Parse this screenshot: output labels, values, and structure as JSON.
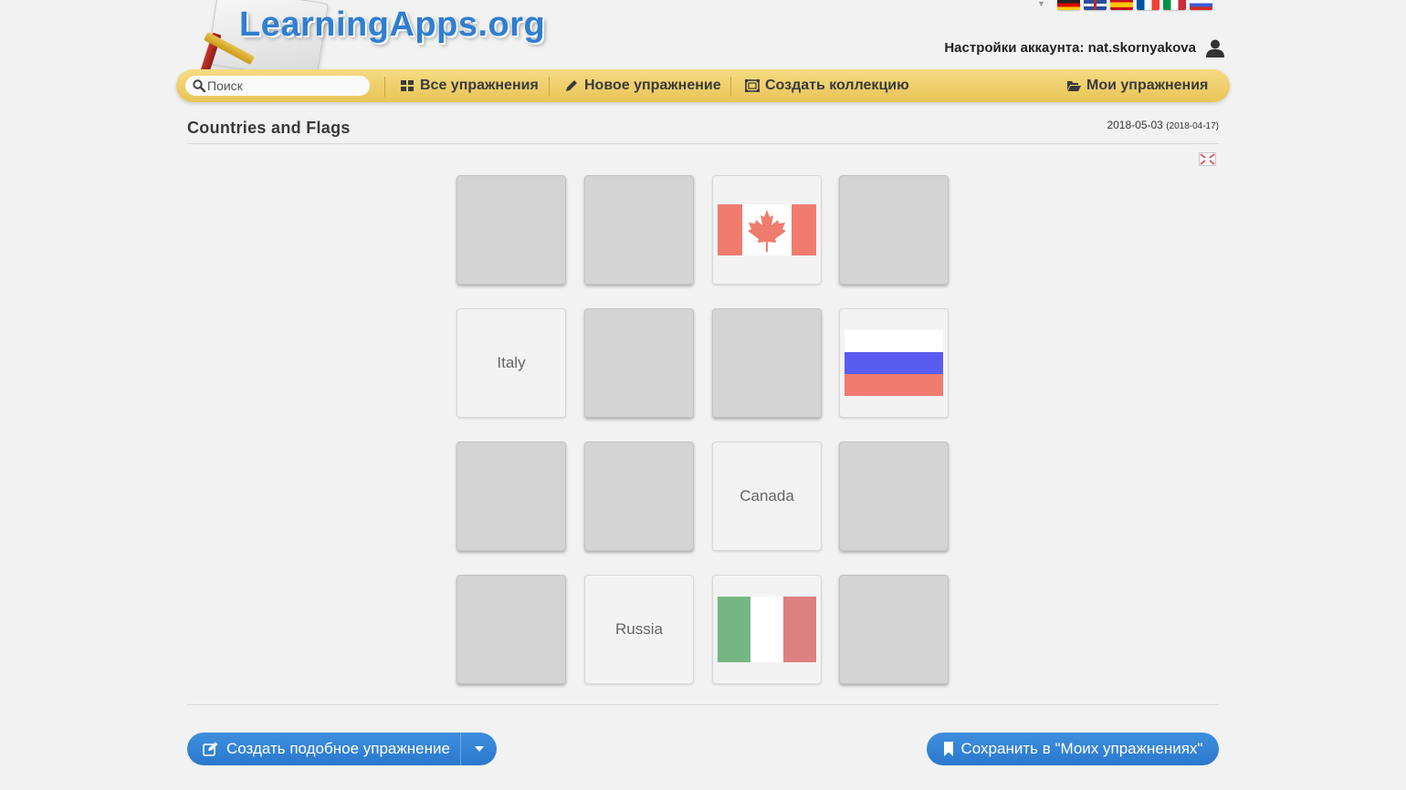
{
  "header": {
    "logo_text": "LearningApps.org",
    "account_label": "Настройки аккаунта: nat.skornyakova",
    "languages": [
      "de",
      "en",
      "es",
      "fr",
      "it",
      "ru"
    ]
  },
  "nav": {
    "search_placeholder": "Поиск",
    "all_exercises": "Все упражнения",
    "new_exercise": "Новое упражнение",
    "create_collection": "Создать коллекцию",
    "my_exercises": "Мои упражнения"
  },
  "page": {
    "title": "Countries and Flags",
    "date": "2018-05-03",
    "date_created": "(2018-04-17)"
  },
  "cards": [
    {
      "state": "hidden"
    },
    {
      "state": "hidden"
    },
    {
      "state": "open",
      "flag": "canada"
    },
    {
      "state": "hidden"
    },
    {
      "state": "open",
      "text": "Italy"
    },
    {
      "state": "hidden"
    },
    {
      "state": "hidden"
    },
    {
      "state": "open",
      "flag": "russia"
    },
    {
      "state": "hidden"
    },
    {
      "state": "hidden"
    },
    {
      "state": "open",
      "text": "Canada"
    },
    {
      "state": "hidden"
    },
    {
      "state": "hidden"
    },
    {
      "state": "open",
      "text": "Russia"
    },
    {
      "state": "open",
      "flag": "italy"
    },
    {
      "state": "hidden"
    }
  ],
  "colors": {
    "canada_red": "#f07b6f",
    "russia_blue": "#5a5cf0",
    "russia_red": "#f07b6f",
    "italy_green": "#74b784",
    "italy_red": "#de8080",
    "button_blue": "#2f80d4",
    "nav_yellow": "#efcf6c"
  },
  "footer": {
    "create_similar": "Создать подобное упражнение",
    "save_to_my": "Сохранить в \"Моих упражнениях\""
  }
}
